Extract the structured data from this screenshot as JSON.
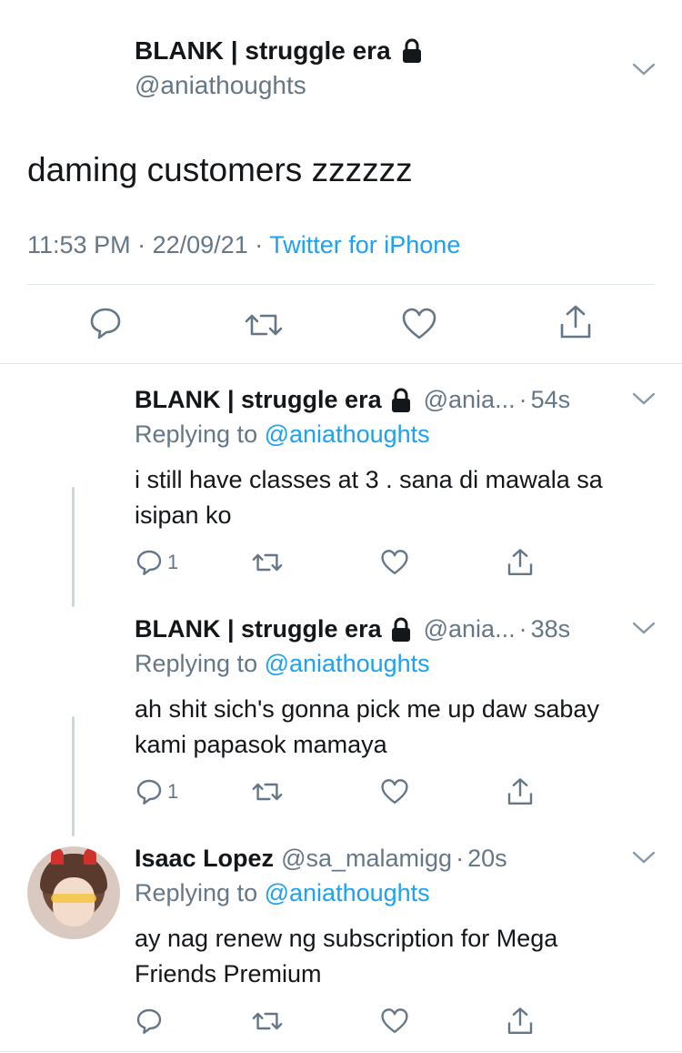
{
  "main_tweet": {
    "display_name": "BLANK | struggle era",
    "handle": "@aniathoughts",
    "text": "daming customers zzzzzz",
    "time": "11:53 PM",
    "date": "22/09/21",
    "source": "Twitter for iPhone"
  },
  "replies": [
    {
      "display_name": "BLANK | struggle era",
      "handle_short": "@ania...",
      "age": "54s",
      "replying_label": "Replying to",
      "replying_handle": "@aniathoughts",
      "text": "i still have classes at 3 . sana di mawala sa isipan ko",
      "reply_count": "1"
    },
    {
      "display_name": "BLANK | struggle era",
      "handle_short": "@ania...",
      "age": "38s",
      "replying_label": "Replying to",
      "replying_handle": "@aniathoughts",
      "text": "ah shit sich's gonna pick me up daw sabay kami papasok mamaya",
      "reply_count": "1"
    },
    {
      "display_name": "Isaac Lopez",
      "handle_short": "@sa_malamigg",
      "age": "20s",
      "replying_label": "Replying to",
      "replying_handle": "@aniathoughts",
      "text": "ay nag renew ng subscription for Mega Friends Premium",
      "reply_count": ""
    }
  ],
  "separator": "·",
  "icons": {
    "reply": "comment-bubble-icon",
    "retweet": "retweet-icon",
    "like": "heart-icon",
    "share": "share-upload-icon",
    "more": "chevron-down-icon",
    "protected": "lock-icon"
  },
  "colors": {
    "link": "#1da1f2",
    "secondary": "#657786",
    "text": "#14171a",
    "divider": "#e1e8ed"
  }
}
